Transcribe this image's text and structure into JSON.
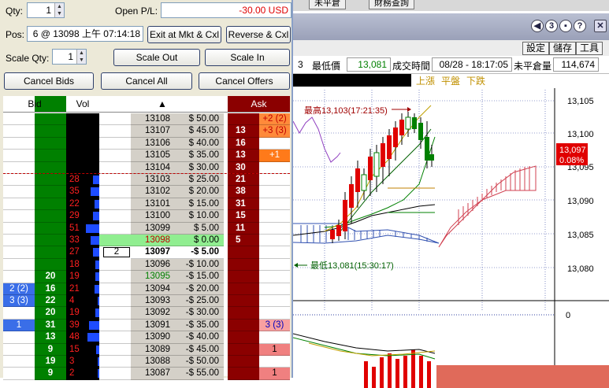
{
  "chart_window": {
    "top_buttons": [
      "未平倉",
      "財務查詢"
    ],
    "menu": [
      "設定",
      "儲存",
      "工具"
    ],
    "quote": {
      "low_label": "最低價",
      "low_value": "13,081",
      "time_label": "成交時間",
      "time_value": "08/28 - 18:17:05",
      "oi_label": "未平倉量",
      "oi_value": "114,674",
      "legend_up": "上漲",
      "legend_flat": "平盤",
      "legend_down": "下跌"
    },
    "annotations": {
      "high": "最高13,103(17:21:35)",
      "low": "最低13,081(15:30:17)"
    },
    "price_axis": [
      "13,105",
      "13,100",
      "13,095",
      "13,090",
      "13,085",
      "13,080"
    ],
    "volume_axis": "0",
    "current_price": "13,097",
    "current_change": "0.08%",
    "titlebar_icons": [
      "3",
      "?"
    ]
  },
  "dom": {
    "qty_label": "Qty:",
    "qty_value": "1",
    "pnl_label": "Open P/L:",
    "pnl_value": "-30.00 USD",
    "pos_label": "Pos:",
    "pos_value": "6 @ 13098 上午 07:14:18",
    "exit_button": "Exit at Mkt & Cxl",
    "reverse_button": "Reverse & Cxl",
    "scale_label": "Scale Qty:",
    "scale_value": "1",
    "scale_out_button": "Scale Out",
    "scale_in_button": "Scale In",
    "cancel_bids_button": "Cancel Bids",
    "cancel_all_button": "Cancel All",
    "cancel_offers_button": "Cancel Offers",
    "headers": {
      "bid": "Bid",
      "vol": "Vol",
      "sort": "▲",
      "ask": "Ask"
    },
    "colors": {
      "bid": "#008000",
      "ask": "#8b0000",
      "position_row": "#90ee90",
      "last_price": "#008000"
    },
    "rows": [
      {
        "bid_orders": "",
        "bid": "",
        "vol": "",
        "vol_frac": 0,
        "trade": "",
        "price": "13108",
        "pnl": "$ 50.00",
        "ask": "",
        "ask_orders": "+2 (2)"
      },
      {
        "bid_orders": "",
        "bid": "",
        "vol": "",
        "vol_frac": 0,
        "trade": "",
        "price": "13107",
        "pnl": "$ 45.00",
        "ask": "13",
        "ask_orders": "+3 (3)"
      },
      {
        "bid_orders": "",
        "bid": "",
        "vol": "",
        "vol_frac": 0,
        "trade": "",
        "price": "13106",
        "pnl": "$ 40.00",
        "ask": "16",
        "ask_orders": ""
      },
      {
        "bid_orders": "",
        "bid": "",
        "vol": "",
        "vol_frac": 0,
        "trade": "",
        "price": "13105",
        "pnl": "$ 35.00",
        "ask": "13",
        "ask_orders": "+1"
      },
      {
        "bid_orders": "",
        "bid": "",
        "vol": "",
        "vol_frac": 0,
        "trade": "",
        "price": "13104",
        "pnl": "$ 30.00",
        "ask": "30",
        "ask_orders": ""
      },
      {
        "bid_orders": "",
        "bid": "",
        "vol": "28",
        "vol_frac": 0.2,
        "trade": "",
        "price": "13103",
        "pnl": "$ 25.00",
        "ask": "21",
        "ask_orders": ""
      },
      {
        "bid_orders": "",
        "bid": "",
        "vol": "35",
        "vol_frac": 0.25,
        "trade": "",
        "price": "13102",
        "pnl": "$ 20.00",
        "ask": "38",
        "ask_orders": ""
      },
      {
        "bid_orders": "",
        "bid": "",
        "vol": "22",
        "vol_frac": 0.15,
        "trade": "",
        "price": "13101",
        "pnl": "$ 15.00",
        "ask": "31",
        "ask_orders": ""
      },
      {
        "bid_orders": "",
        "bid": "",
        "vol": "29",
        "vol_frac": 0.2,
        "trade": "",
        "price": "13100",
        "pnl": "$ 10.00",
        "ask": "15",
        "ask_orders": ""
      },
      {
        "bid_orders": "",
        "bid": "",
        "vol": "51",
        "vol_frac": 0.4,
        "trade": "",
        "price": "13099",
        "pnl": "$ 5.00",
        "ask": "11",
        "ask_orders": ""
      },
      {
        "bid_orders": "",
        "bid": "",
        "vol": "33",
        "vol_frac": 0.25,
        "trade": "▶",
        "price": "13098",
        "pnl": "$ 0.00",
        "ask": "5",
        "ask_orders": "",
        "position": true
      },
      {
        "bid_orders": "",
        "bid": "",
        "vol": "27",
        "vol_frac": 0.2,
        "trade": "2",
        "price": "13097",
        "pnl": "-$ 5.00",
        "ask": "",
        "ask_orders": "",
        "current": true
      },
      {
        "bid_orders": "",
        "bid": "",
        "vol": "18",
        "vol_frac": 0.12,
        "trade": "",
        "price": "13096",
        "pnl": "-$ 10.00",
        "ask": "",
        "ask_orders": ""
      },
      {
        "bid_orders": "",
        "bid": "20",
        "vol": "19",
        "vol_frac": 0.12,
        "trade": "",
        "price": "13095",
        "pnl": "-$ 15.00",
        "ask": "",
        "ask_orders": "",
        "last": true
      },
      {
        "bid_orders": "2 (2)",
        "bid": "16",
        "vol": "21",
        "vol_frac": 0.15,
        "trade": "",
        "price": "13094",
        "pnl": "-$ 20.00",
        "ask": "",
        "ask_orders": ""
      },
      {
        "bid_orders": "3 (3)",
        "bid": "22",
        "vol": "4",
        "vol_frac": 0.04,
        "trade": "",
        "price": "13093",
        "pnl": "-$ 25.00",
        "ask": "",
        "ask_orders": ""
      },
      {
        "bid_orders": "",
        "bid": "20",
        "vol": "19",
        "vol_frac": 0.12,
        "trade": "",
        "price": "13092",
        "pnl": "-$ 30.00",
        "ask": "",
        "ask_orders": ""
      },
      {
        "bid_orders": "1",
        "bid": "31",
        "vol": "39",
        "vol_frac": 0.3,
        "trade": "",
        "price": "13091",
        "pnl": "-$ 35.00",
        "ask": "",
        "ask_orders": "3 (3)"
      },
      {
        "bid_orders": "",
        "bid": "13",
        "vol": "48",
        "vol_frac": 0.35,
        "trade": "",
        "price": "13090",
        "pnl": "-$ 40.00",
        "ask": "",
        "ask_orders": ""
      },
      {
        "bid_orders": "",
        "bid": "9",
        "vol": "15",
        "vol_frac": 0.1,
        "trade": "",
        "price": "13089",
        "pnl": "-$ 45.00",
        "ask": "",
        "ask_orders": "1"
      },
      {
        "bid_orders": "",
        "bid": "19",
        "vol": "3",
        "vol_frac": 0.03,
        "trade": "",
        "price": "13088",
        "pnl": "-$ 50.00",
        "ask": "",
        "ask_orders": ""
      },
      {
        "bid_orders": "",
        "bid": "9",
        "vol": "2",
        "vol_frac": 0.02,
        "trade": "",
        "price": "13087",
        "pnl": "-$ 55.00",
        "ask": "",
        "ask_orders": "1"
      }
    ]
  }
}
